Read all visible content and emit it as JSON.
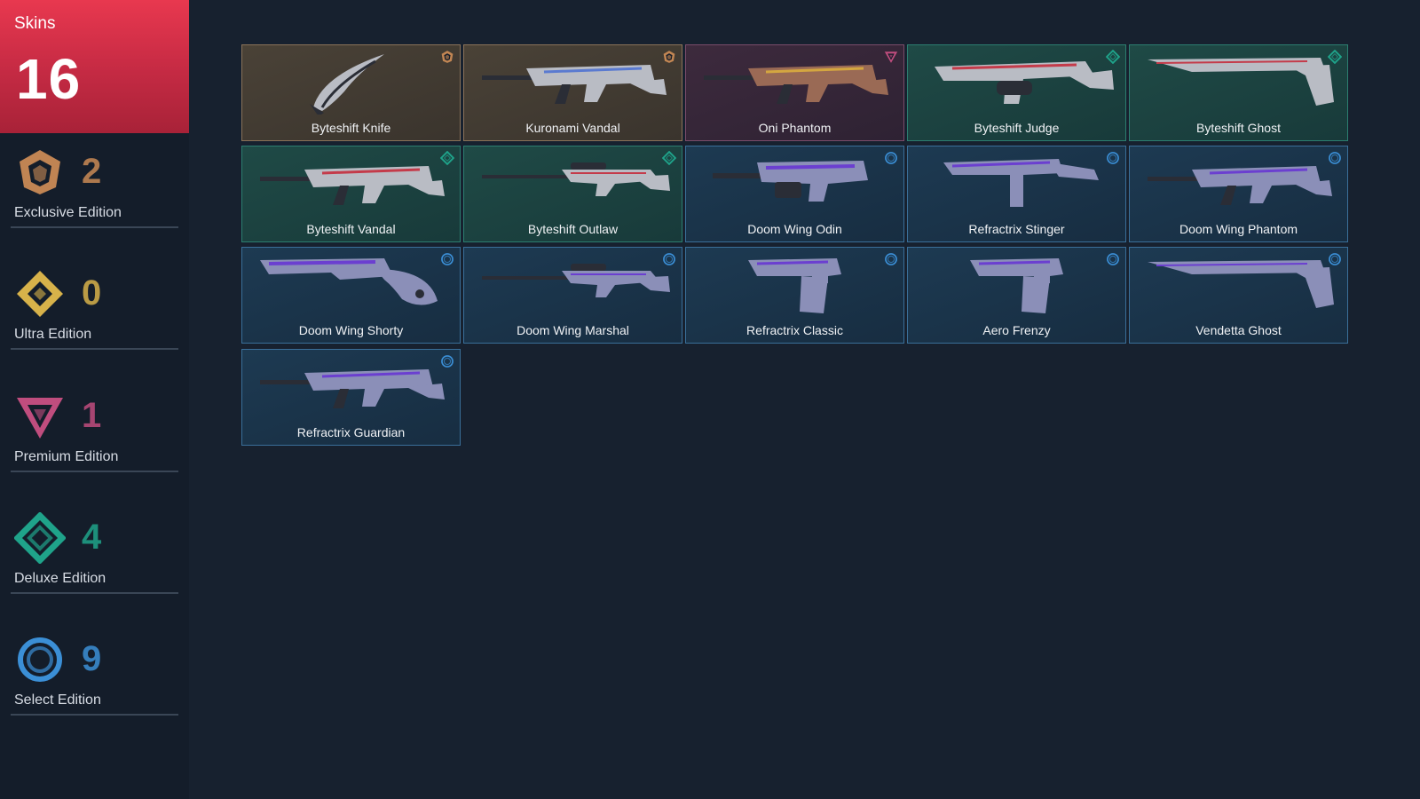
{
  "header": {
    "label": "Skins",
    "count": "16"
  },
  "tiers": [
    {
      "label": "Exclusive Edition",
      "count": "2",
      "icon": "exclusive-edition-icon",
      "color": "#c98a55"
    },
    {
      "label": "Ultra Edition",
      "count": "0",
      "icon": "ultra-edition-icon",
      "color": "#d7b24a"
    },
    {
      "label": "Premium Edition",
      "count": "1",
      "icon": "premium-edition-icon",
      "color": "#c04d7e"
    },
    {
      "label": "Deluxe Edition",
      "count": "4",
      "icon": "deluxe-edition-icon",
      "color": "#1fa38a"
    },
    {
      "label": "Select Edition",
      "count": "9",
      "icon": "select-edition-icon",
      "color": "#3b8fd6"
    }
  ],
  "skins": [
    {
      "name": "Byteshift Knife",
      "tier": "exclusive",
      "weapon": "knife"
    },
    {
      "name": "Kuronami Vandal",
      "tier": "exclusive",
      "weapon": "rifle"
    },
    {
      "name": "Oni Phantom",
      "tier": "premium",
      "weapon": "rifle"
    },
    {
      "name": "Byteshift Judge",
      "tier": "deluxe",
      "weapon": "shotgun"
    },
    {
      "name": "Byteshift Ghost",
      "tier": "deluxe",
      "weapon": "pistol"
    },
    {
      "name": "Byteshift Vandal",
      "tier": "deluxe",
      "weapon": "rifle"
    },
    {
      "name": "Byteshift Outlaw",
      "tier": "deluxe",
      "weapon": "sniper"
    },
    {
      "name": "Doom Wing Odin",
      "tier": "select",
      "weapon": "heavy"
    },
    {
      "name": "Refractrix Stinger",
      "tier": "select",
      "weapon": "smg"
    },
    {
      "name": "Doom Wing Phantom",
      "tier": "select",
      "weapon": "rifle"
    },
    {
      "name": "Doom Wing Shorty",
      "tier": "select",
      "weapon": "shorty"
    },
    {
      "name": "Doom Wing Marshal",
      "tier": "select",
      "weapon": "sniper"
    },
    {
      "name": "Refractrix Classic",
      "tier": "select",
      "weapon": "pistol-small"
    },
    {
      "name": "Aero Frenzy",
      "tier": "select",
      "weapon": "pistol-small"
    },
    {
      "name": "Vendetta Ghost",
      "tier": "select",
      "weapon": "pistol"
    },
    {
      "name": "Refractrix Guardian",
      "tier": "select",
      "weapon": "rifle"
    }
  ]
}
